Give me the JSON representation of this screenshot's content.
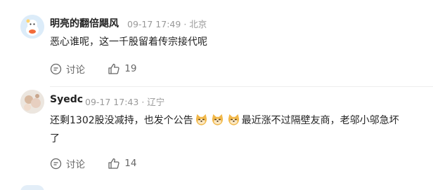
{
  "comments": [
    {
      "username": "明亮的翻倍飓风",
      "time": "09-17 17:49",
      "location": "北京",
      "text": "恶心谁呢，这一千股留着传宗接代呢",
      "reply_label": "讨论",
      "like_count": "19"
    },
    {
      "username": "Syedc",
      "time": "09-17 17:43",
      "location": "辽宁",
      "text_before_emoji": "还剩1302股没减持，也发个公告",
      "text_after_emoji": "最近涨不过隔壁友商，老邬小邬急坏",
      "text_line2": "了",
      "reply_label": "讨论",
      "like_count": "14"
    }
  ],
  "colors": {
    "name": "#222222",
    "meta": "#999999",
    "action": "#666666"
  },
  "icons": [
    "chat-bubble-icon",
    "thumbs-up-icon",
    "doge-emoji-icon"
  ]
}
